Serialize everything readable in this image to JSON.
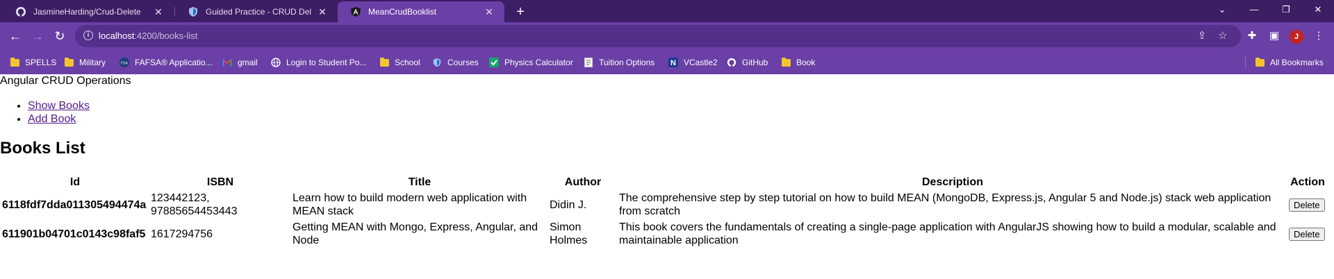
{
  "browser": {
    "tabs": [
      {
        "title": "JasmineHarding/Crud-Delete",
        "icon": "github-icon",
        "active": false
      },
      {
        "title": "Guided Practice - CRUD Delete.p",
        "icon": "shield-icon",
        "active": false
      },
      {
        "title": "MeanCrudBooklist",
        "icon": "angular-icon",
        "active": true
      }
    ],
    "address": {
      "host": "localhost",
      "path": ":4200/books-list"
    },
    "avatar_initial": "J",
    "bookmarks": [
      {
        "label": "SPELLS",
        "icon": "folder-icon"
      },
      {
        "label": "Military",
        "icon": "folder-icon"
      },
      {
        "label": "FAFSA® Applicatio...",
        "icon": "fafsa-icon"
      },
      {
        "label": "gmail",
        "icon": "gmail-icon"
      },
      {
        "label": "Login to Student Po...",
        "icon": "globe-icon"
      },
      {
        "label": "School",
        "icon": "folder-icon"
      },
      {
        "label": "Courses",
        "icon": "shield-icon"
      },
      {
        "label": "Physics Calculator",
        "icon": "check-icon"
      },
      {
        "label": "Tuition Options",
        "icon": "document-icon"
      },
      {
        "label": "VCastle2",
        "icon": "n-icon"
      },
      {
        "label": "GitHub",
        "icon": "github-icon"
      },
      {
        "label": "Book",
        "icon": "folder-icon"
      }
    ],
    "all_bookmarks": "All Bookmarks",
    "colors": {
      "frame": "#3b1e63",
      "toolbar": "#6a3fa6",
      "omnibox": "#54308a"
    }
  },
  "app": {
    "title": "Angular CRUD Operations",
    "nav": [
      "Show Books",
      "Add Book"
    ],
    "heading": "Books List",
    "columns": [
      "Id",
      "ISBN",
      "Title",
      "Author",
      "Description",
      "Action"
    ],
    "books": [
      {
        "id": "6118fdf7dda011305494474a",
        "isbn": "123442123, 97885654453443",
        "title": "Learn how to build modern web application with MEAN stack",
        "author": "Didin J.",
        "description": "The comprehensive step by step tutorial on how to build MEAN (MongoDB, Express.js, Angular 5 and Node.js) stack web application from scratch",
        "action": "Delete"
      },
      {
        "id": "611901b04701c0143c98faf5",
        "isbn": "1617294756",
        "title": "Getting MEAN with Mongo, Express, Angular, and Node",
        "author": "Simon Holmes",
        "description": "This book covers the fundamentals of creating a single-page application with AngularJS showing how to build a modular, scalable and maintainable application",
        "action": "Delete"
      }
    ]
  }
}
